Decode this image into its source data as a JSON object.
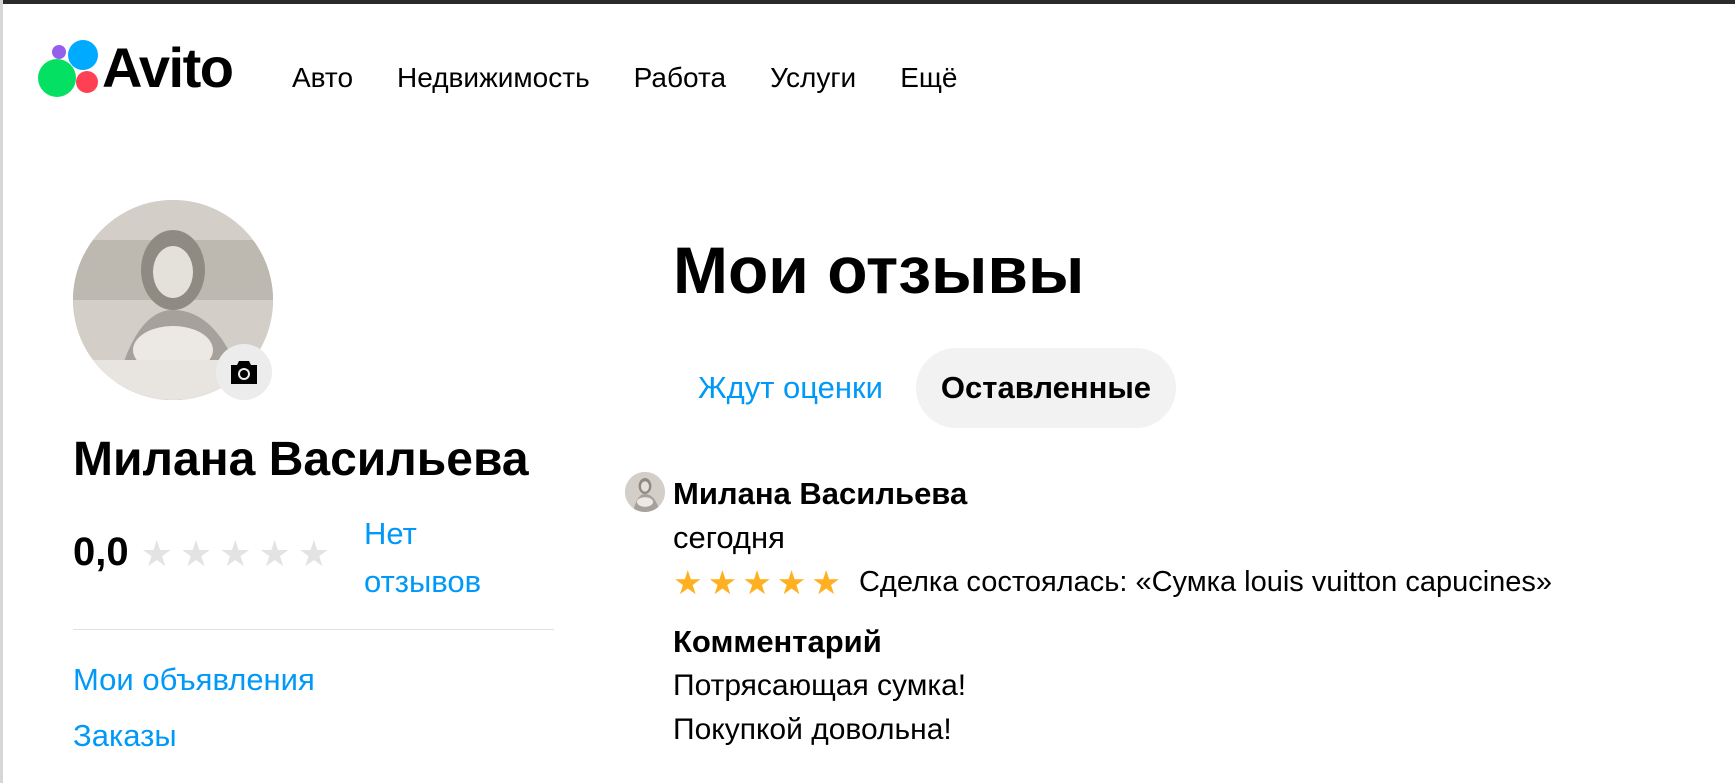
{
  "brand": {
    "logo_text": "Avito"
  },
  "nav": {
    "items": [
      {
        "label": "Авто"
      },
      {
        "label": "Недвижимость"
      },
      {
        "label": "Работа"
      },
      {
        "label": "Услуги"
      },
      {
        "label": "Ещё"
      }
    ]
  },
  "profile": {
    "name": "Милана Васильева",
    "rating_value": "0,0",
    "rating_stars": 0,
    "no_reviews_label": "Нет отзывов",
    "menu": [
      {
        "label": "Мои объявления"
      },
      {
        "label": "Заказы"
      }
    ]
  },
  "main": {
    "title": "Мои отзывы",
    "tabs": [
      {
        "label": "Ждут оценки",
        "active": false
      },
      {
        "label": "Оставленные",
        "active": true
      }
    ],
    "review": {
      "author": "Милана Васильева",
      "date": "сегодня",
      "stars": 5,
      "deal": "Сделка состоялась: «Сумка louis vuitton capucines»",
      "comment_label": "Комментарий",
      "comment_lines": [
        "Потрясающая сумка!",
        "Покупкой довольна!"
      ]
    }
  },
  "icons": {
    "camera": "camera-icon",
    "star_empty": "star-outline-icon",
    "star_filled": "star-filled-icon"
  },
  "colors": {
    "link": "#0099f7",
    "star_active": "#ffb021",
    "star_inactive": "#e3e3e3",
    "tab_active_bg": "#f2f2f2",
    "logo_green": "#04e061",
    "logo_blue": "#00aaff",
    "logo_red": "#ff4053",
    "logo_purple": "#965eeb"
  }
}
